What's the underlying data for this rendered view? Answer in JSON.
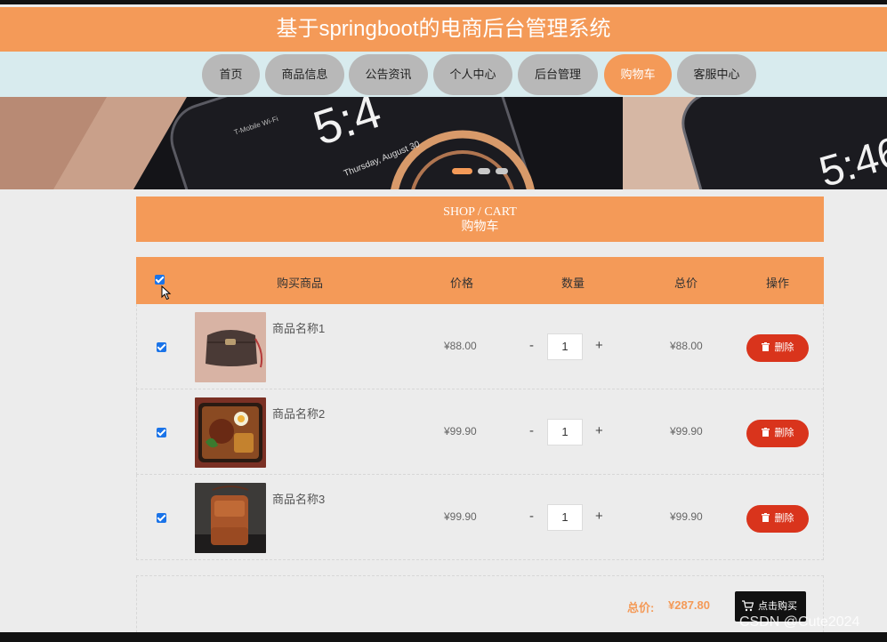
{
  "header": {
    "title": "基于springboot的电商后台管理系统"
  },
  "nav": {
    "items": [
      {
        "label": "首页"
      },
      {
        "label": "商品信息"
      },
      {
        "label": "公告资讯"
      },
      {
        "label": "个人中心"
      },
      {
        "label": "后台管理"
      },
      {
        "label": "购物车",
        "active": true
      },
      {
        "label": "客服中心"
      }
    ]
  },
  "banner": {
    "slide_count": 3,
    "active_slide": 1,
    "clock_left": "5:4",
    "clock_right": "5:46",
    "date_text": "Thursday, August 30",
    "carrier_text": "T-Mobile Wi-Fi"
  },
  "cart_header": {
    "title_en": "SHOP / CART",
    "title_cn": "购物车"
  },
  "table": {
    "columns": [
      "购买商品",
      "价格",
      "数量",
      "总价",
      "操作"
    ],
    "select_all_checked": true,
    "rows": [
      {
        "name": "商品名称1",
        "price": "¥88.00",
        "qty": "1",
        "total": "¥88.00",
        "checked": true,
        "image": "handbag-icon",
        "delete_label": "删除"
      },
      {
        "name": "商品名称2",
        "price": "¥99.90",
        "qty": "1",
        "total": "¥99.90",
        "checked": true,
        "image": "food-box-icon",
        "delete_label": "删除"
      },
      {
        "name": "商品名称3",
        "price": "¥99.90",
        "qty": "1",
        "total": "¥99.90",
        "checked": true,
        "image": "shoulder-bag-icon",
        "delete_label": "删除"
      }
    ],
    "qty_minus": "-",
    "qty_plus": "+"
  },
  "summary": {
    "label": "总价:",
    "value": "¥287.80",
    "buy_label": "点击购买"
  },
  "watermark": "CSDN @Cute2024",
  "colors": {
    "accent": "#f49a58",
    "nav_bg": "#d8ebee",
    "delete": "#d9341c",
    "buy": "#111111",
    "checkbox": "#1a73e8"
  }
}
